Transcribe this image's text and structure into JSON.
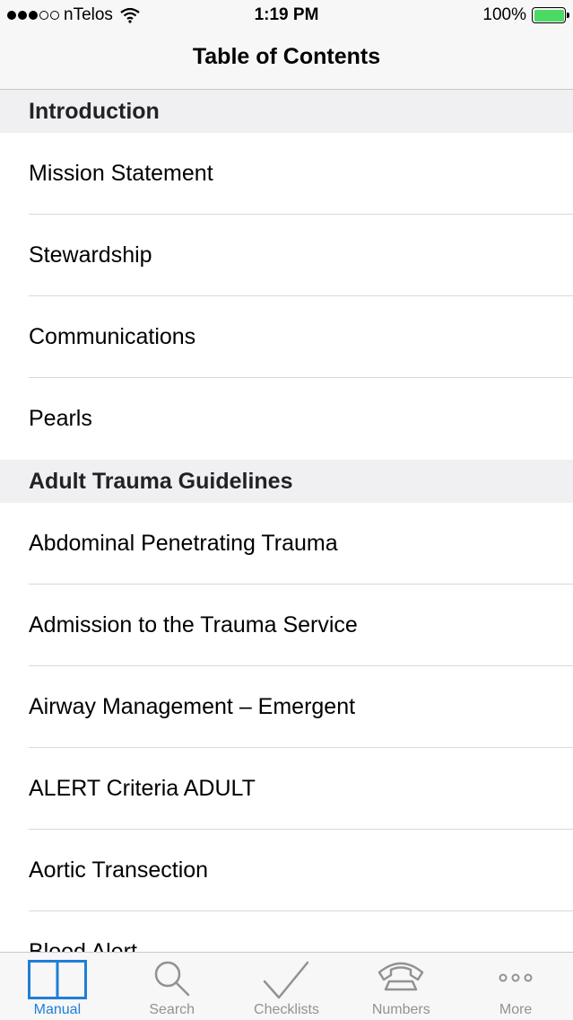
{
  "status_bar": {
    "carrier": "nTelos",
    "time": "1:19 PM",
    "battery": "100%",
    "battery_color": "#4cd964"
  },
  "nav": {
    "title": "Table of Contents"
  },
  "sections": [
    {
      "header": "Introduction",
      "items": [
        "Mission Statement",
        "Stewardship",
        "Communications",
        "Pearls"
      ]
    },
    {
      "header": "Adult Trauma Guidelines",
      "items": [
        "Abdominal Penetrating Trauma",
        "Admission to the Trauma Service",
        "Airway Management – Emergent",
        "ALERT Criteria ADULT",
        "Aortic Transection",
        "Blood Alert"
      ]
    }
  ],
  "tabs": [
    {
      "label": "Manual",
      "icon": "book-icon",
      "active": true
    },
    {
      "label": "Search",
      "icon": "search-icon",
      "active": false
    },
    {
      "label": "Checklists",
      "icon": "checkmark-icon",
      "active": false
    },
    {
      "label": "Numbers",
      "icon": "phone-icon",
      "active": false
    },
    {
      "label": "More",
      "icon": "more-icon",
      "active": false
    }
  ],
  "colors": {
    "accent": "#1f7ed6",
    "inactive": "#929292"
  }
}
